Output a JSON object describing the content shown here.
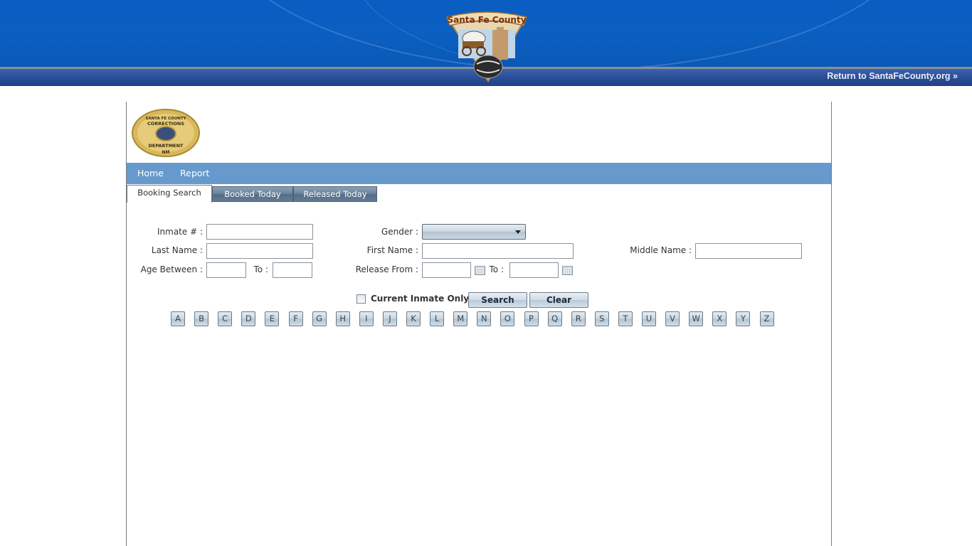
{
  "header": {
    "logo_text": "Santa Fe County",
    "return_link": "Return to SantaFeCounty.org »"
  },
  "badge": {
    "line1": "SANTA FE COUNTY",
    "line2": "CORRECTIONS",
    "line3": "DEPARTMENT",
    "line4": "NM"
  },
  "nav": {
    "items": [
      {
        "label": "Home"
      },
      {
        "label": "Report"
      }
    ]
  },
  "tabs": [
    {
      "label": "Booking Search",
      "active": true
    },
    {
      "label": "Booked Today",
      "active": false
    },
    {
      "label": "Released Today",
      "active": false
    }
  ],
  "form": {
    "inmate_label": "Inmate # :",
    "inmate_value": "",
    "last_name_label": "Last Name :",
    "last_name_value": "",
    "age_between_label": "Age Between :",
    "age_from_value": "",
    "age_to_label": "To :",
    "age_to_value": "",
    "gender_label": "Gender :",
    "gender_value": "",
    "first_name_label": "First Name :",
    "first_name_value": "",
    "release_from_label": "Release From :",
    "release_from_value": "",
    "release_to_label": "To :",
    "release_to_value": "",
    "middle_name_label": "Middle Name :",
    "middle_name_value": "",
    "current_inmate_label": "Current Inmate Only",
    "current_inmate_checked": false,
    "search_label": "Search",
    "clear_label": "Clear"
  },
  "letters": [
    "A",
    "B",
    "C",
    "D",
    "E",
    "F",
    "G",
    "H",
    "I",
    "J",
    "K",
    "L",
    "M",
    "N",
    "O",
    "P",
    "Q",
    "R",
    "S",
    "T",
    "U",
    "V",
    "W",
    "X",
    "Y",
    "Z"
  ]
}
